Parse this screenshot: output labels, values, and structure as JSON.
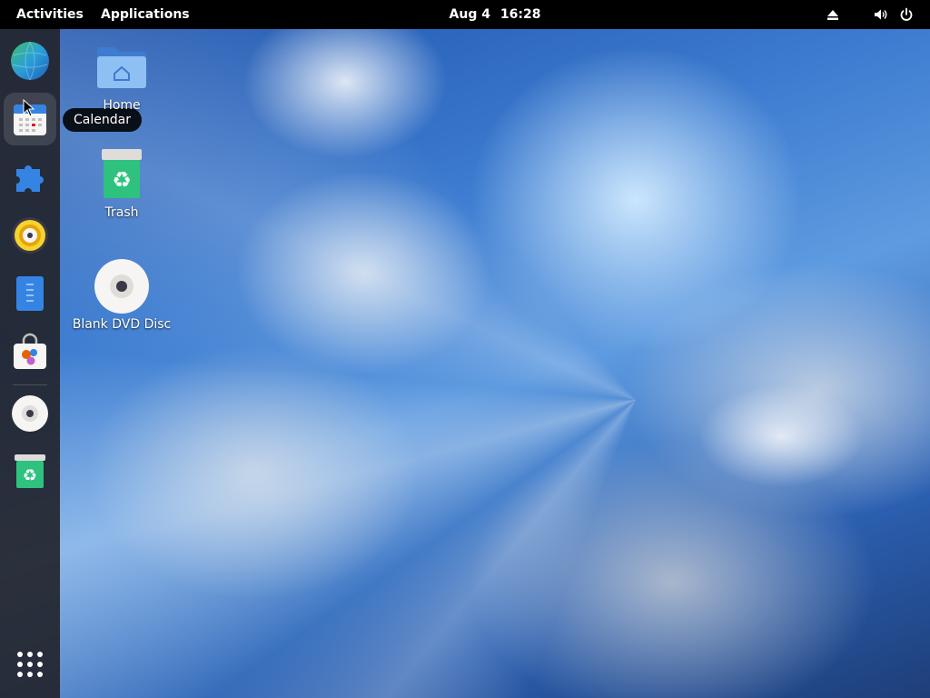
{
  "topbar": {
    "activities": "Activities",
    "applications": "Applications",
    "date": "Aug 4",
    "time": "16:28"
  },
  "dock": {
    "items": [
      {
        "name": "Web Browser",
        "icon": "globe-icon"
      },
      {
        "name": "Calendar",
        "icon": "calendar-icon",
        "active": true
      },
      {
        "name": "Extensions",
        "icon": "puzzle-icon"
      },
      {
        "name": "Rhythmbox",
        "icon": "speaker-icon"
      },
      {
        "name": "Text Editor",
        "icon": "document-icon"
      },
      {
        "name": "Software",
        "icon": "shopping-bag-icon"
      },
      {
        "name": "Disc",
        "icon": "disc-icon"
      },
      {
        "name": "Trash",
        "icon": "trash-icon"
      },
      {
        "name": "Show Applications",
        "icon": "app-grid-icon"
      }
    ]
  },
  "tooltip": {
    "text": "Calendar"
  },
  "desktop": {
    "icons": [
      {
        "label": "Home",
        "icon": "folder-home-icon"
      },
      {
        "label": "Trash",
        "icon": "trash-icon"
      },
      {
        "label": "Blank DVD Disc",
        "icon": "dvd-disc-icon"
      }
    ]
  },
  "colors": {
    "topbar_bg": "#000000",
    "dock_bg": "#22242c",
    "sky_blue": "#3d7cd0",
    "trash_green": "#2ec27e",
    "folder_blue": "#5e9ee8"
  }
}
